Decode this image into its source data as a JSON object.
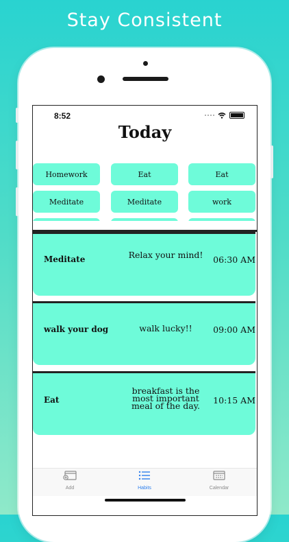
{
  "headline": "Stay Consistent",
  "status": {
    "time": "8:52"
  },
  "title": "Today",
  "chips": [
    "Homework",
    "Eat",
    "Eat",
    "Meditate",
    "Meditate",
    "work"
  ],
  "habits": [
    {
      "name": "Meditate",
      "description": "Relax your mind!",
      "time": "06:30 AM"
    },
    {
      "name": "walk your dog",
      "description": "walk lucky!!",
      "time": "09:00 AM"
    },
    {
      "name": "Eat",
      "description": "breakfast is the most important meal of the day.",
      "time": "10:15 AM"
    }
  ],
  "tabs": {
    "add": "Add",
    "habits": "Habits",
    "calendar": "Calendar"
  },
  "colors": {
    "accent": "#6efbd9",
    "tab_active": "#2f80ed",
    "background_top": "#29d3d0"
  },
  "icons": {
    "add": "calendar-add-icon",
    "habits": "list-icon",
    "calendar": "calendar-icon"
  }
}
